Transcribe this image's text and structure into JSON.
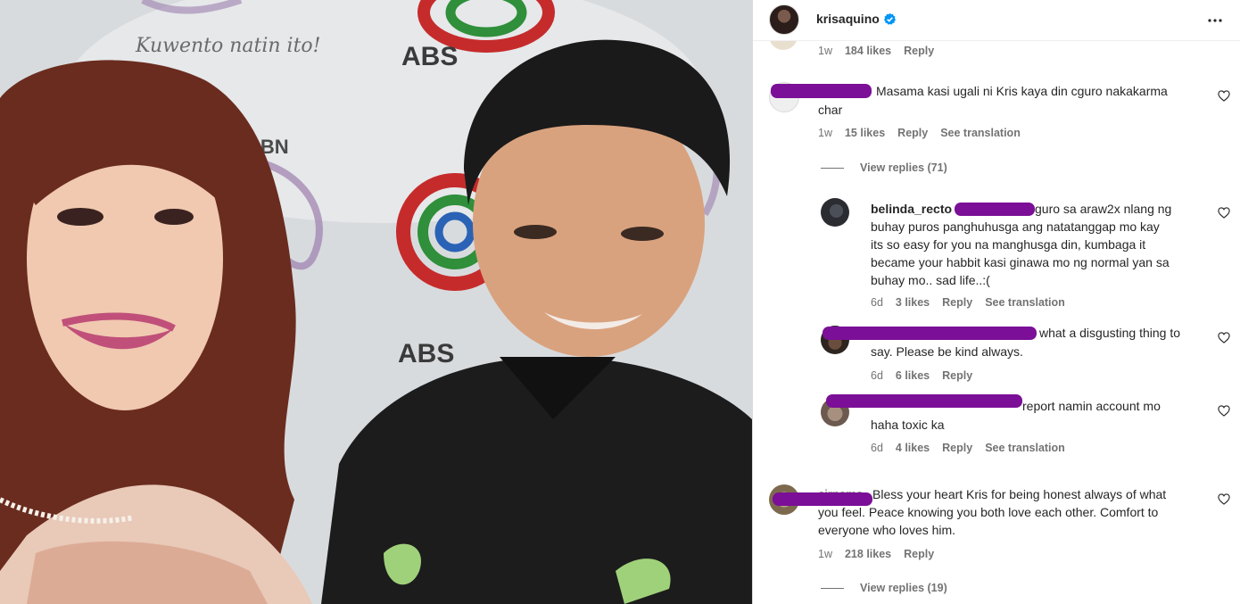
{
  "post": {
    "username": "krisaquino",
    "photo_texts": {
      "banner_script": "Kuwento natin ito!",
      "logo_top": "ABS",
      "logo_mid": "ABS",
      "cbn_text": "CBN"
    }
  },
  "colors": {
    "redaction": "#7b0f97",
    "verified": "#0095f6",
    "meta": "#737373"
  },
  "comments": [
    {
      "id": "c0",
      "time": "1w",
      "likes": "184 likes",
      "reply": "Reply"
    },
    {
      "id": "c1",
      "text_line1": "Masama kasi ugali ni Kris kaya din cguro nakakarma",
      "text_line2": "char",
      "time": "1w",
      "likes": "15 likes",
      "reply": "Reply",
      "translation": "See translation",
      "view_replies": "View replies (71)"
    },
    {
      "id": "r1",
      "username": "belinda_recto",
      "lines": [
        "guro sa araw2x nlang ng",
        "buhay puros panghuhusga ang natatanggap mo kay",
        "its so easy for you na manghusga din, kumbaga it",
        "became your habbit kasi ginawa mo ng normal yan sa",
        "buhay mo.. sad life..:("
      ],
      "time": "6d",
      "likes": "3 likes",
      "reply": "Reply",
      "translation": "See translation"
    },
    {
      "id": "r2",
      "lines": [
        "what a disgusting thing to",
        "say. Please be kind always."
      ],
      "time": "6d",
      "likes": "6 likes",
      "reply": "Reply"
    },
    {
      "id": "r3",
      "lines": [
        "report namin account mo",
        "haha toxic ka"
      ],
      "time": "6d",
      "likes": "4 likes",
      "reply": "Reply",
      "translation": "See translation"
    },
    {
      "id": "c2",
      "username_partial": "cirnamo",
      "lines": [
        "Bless your heart Kris for being honest always of what",
        "you feel. Peace knowing you both love each other. Comfort to",
        "everyone who loves him."
      ],
      "time": "1w",
      "likes": "218 likes",
      "reply": "Reply",
      "view_replies": "View replies (19)"
    }
  ]
}
